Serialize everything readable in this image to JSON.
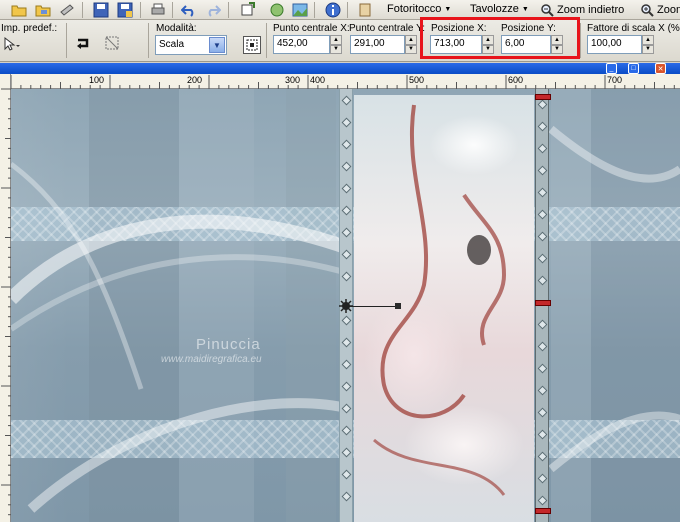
{
  "toolbar": {
    "menus": [
      {
        "label": "Fotoritocco",
        "icon": "retouch-icon"
      },
      {
        "label": "Tavolozze",
        "icon": "palettes-icon"
      },
      {
        "label": "Zoom indietro",
        "icon": "zoom-out-icon"
      },
      {
        "label": "Zoom",
        "icon": "zoom-in-icon"
      }
    ]
  },
  "options": {
    "preset_label": "Imp. predef.:",
    "mode_label": "Modalità:",
    "mode_value": "Scala",
    "center_x_label": "Punto centrale X:",
    "center_x_value": "452,00",
    "center_y_label": "Punto centrale Y:",
    "center_y_value": "291,00",
    "pos_x_label": "Posizione X:",
    "pos_x_value": "713,00",
    "pos_y_label": "Posizione Y:",
    "pos_y_value": "6,00",
    "scale_x_label": "Fattore di scala X (%):",
    "scale_x_value": "100,00"
  },
  "ruler": {
    "marks": [
      "100",
      "200",
      "300",
      "400",
      "500",
      "600",
      "700"
    ]
  },
  "watermark": {
    "title": "Pinuccia",
    "url": "www.maidiregrafica.eu"
  },
  "colors": {
    "highlight": "#e8141b",
    "titlebar": "#0a4cc6"
  }
}
